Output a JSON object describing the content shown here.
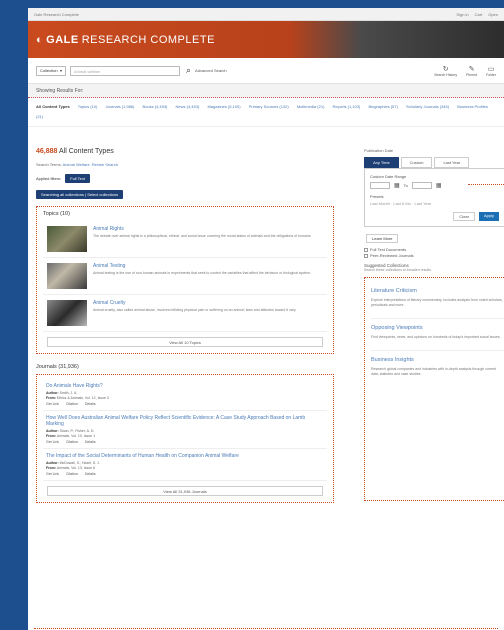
{
  "browser": {
    "address": "Gale Research Complete",
    "tools": [
      "Sign in",
      "Cart",
      "Open"
    ]
  },
  "header": {
    "logo_gale": "GALE",
    "logo_rest": "RESEARCH COMPLETE"
  },
  "search": {
    "select_value": "Collection",
    "placeholder": "Animal welfare",
    "advanced": "Advanced Search"
  },
  "toolbar": [
    {
      "icon": "history-icon",
      "label": "Search History"
    },
    {
      "icon": "pin-icon",
      "label": "Pinned"
    },
    {
      "icon": "folder-icon",
      "label": "Folder"
    }
  ],
  "showing": "Showing Results For:",
  "filters": [
    {
      "label": "All Content Types",
      "selected": true
    },
    {
      "label": "Topics (10)"
    },
    {
      "label": "Journals (1,986)"
    },
    {
      "label": "Books (4,453)"
    },
    {
      "label": "News (4,453)"
    },
    {
      "label": "Magazines (5,100)"
    },
    {
      "label": "Primary Sources (132)"
    },
    {
      "label": "Multimedia (21)"
    },
    {
      "label": "Reports (1,103)"
    },
    {
      "label": "Biographies (57)"
    },
    {
      "label": "Scholarly Journals (345)"
    },
    {
      "label": "Business Profiles (21)"
    }
  ],
  "results": {
    "count": "46,888",
    "suffix": "All Content Types",
    "applied": "Search Terms",
    "applied_term": "Animal Welfare",
    "clear": "Revise Search"
  },
  "collection": {
    "label": "Applied filters:",
    "button": "Full Text"
  },
  "search_within": {
    "label": "Searching all collections",
    "button": "Select collections"
  },
  "topics": {
    "title": "Topics (10)",
    "items": [
      {
        "title": "Animal Rights",
        "desc": "The debate over animal rights is a philosophical, ethical, and social issue covering the moral status of animals and the obligations of humans."
      },
      {
        "title": "Animal Testing",
        "desc": "Animal testing is the use of non-human animals in experiments that seek to control the variables that affect the behavior or biological system."
      },
      {
        "title": "Animal Cruelty",
        "desc": "Animal cruelty, also called animal abuse, involves inflicting physical pain or suffering on an animal; laws and attitudes toward it vary."
      }
    ],
    "view_all": "View All 10 Topics"
  },
  "journals": {
    "title": "Journals (31,936)",
    "items": [
      {
        "title": "Do Animals Have Rights?",
        "author": "Smith, J. A.",
        "from": "Ethics & Animals, Vol. 12, Issue 3",
        "links": [
          "Get Link",
          "Citation",
          "Details"
        ]
      },
      {
        "title": "How Well Does Australian Animal Welfare Policy Reflect Scientific Evidence: A Case Study Approach Based on Lamb Marking",
        "author": "Sloan, P.; Fisher, A. D.",
        "from": "Animals, Vol. 10, Issue 1",
        "links": [
          "Get Link",
          "Citation",
          "Details"
        ]
      },
      {
        "title": "The Impact of the Social Determinants of Human Health on Companion Animal Welfare",
        "author": "McDowall, S.; Hazel, S. J.",
        "from": "Animals, Vol. 13, Issue 6",
        "links": [
          "Get Link",
          "Citation",
          "Details"
        ]
      }
    ],
    "view_all": "View All 31,936 Journals"
  },
  "sidebar": {
    "publication": "Publication Date",
    "tabs": [
      "Any Time",
      "Custom",
      "Last Year"
    ],
    "date_title": "Custom Date Range",
    "date_sep": "To",
    "presets_title": "Presets",
    "presets": "Last Month · Last 6 Mo · Last Year",
    "clear": "Clear",
    "apply": "Apply",
    "learn": "Learn More",
    "checks": [
      "Full Text Documents",
      "Peer-Reviewed Journals"
    ],
    "suggested_title": "Suggested Collections",
    "suggested_desc": "Search these collections to broaden results.",
    "products": [
      {
        "title": "Literature Criticism",
        "desc": "Explore interpretations of literary commentary. Includes analysis from noted scholars, periodicals and more."
      },
      {
        "title": "Opposing Viewpoints",
        "desc": "Find viewpoints, news, and opinions on hundreds of today's important social issues."
      },
      {
        "title": "Business Insights",
        "desc": "Research global companies and industries with in-depth analysis through current data, statistics and case studies."
      }
    ]
  }
}
